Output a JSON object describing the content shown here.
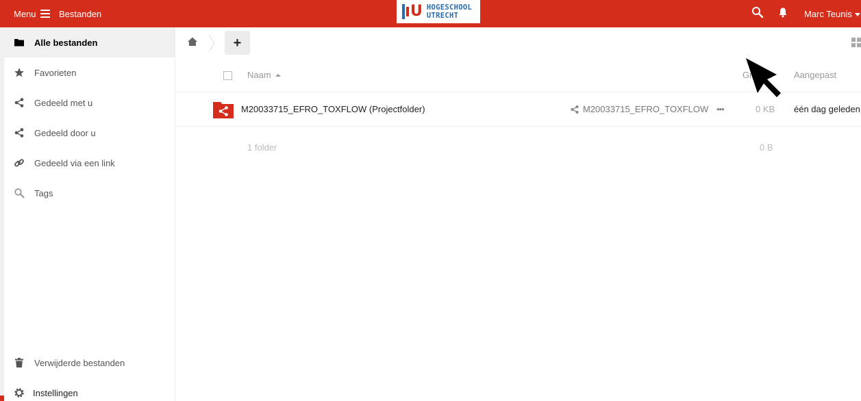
{
  "header": {
    "menu_label": "Menu",
    "app_title": "Bestanden",
    "logo": {
      "line1": "HOGESCHOOL",
      "line2": "UTRECHT",
      "mark": "U"
    },
    "user_name": "Marc Teunis",
    "colors": {
      "bar": "#d42d1b",
      "logo_blue": "#2b6cb0"
    }
  },
  "sidebar": {
    "items": [
      {
        "label": "Alle bestanden",
        "icon": "folder-icon",
        "active": true
      },
      {
        "label": "Favorieten",
        "icon": "star-icon"
      },
      {
        "label": "Gedeeld met u",
        "icon": "share-icon"
      },
      {
        "label": "Gedeeld door u",
        "icon": "share-icon"
      },
      {
        "label": "Gedeeld via een link",
        "icon": "link-icon"
      },
      {
        "label": "Tags",
        "icon": "search-icon"
      }
    ],
    "bottom": [
      {
        "label": "Verwijderde bestanden",
        "icon": "trash-icon"
      },
      {
        "label": "Instellingen",
        "icon": "gear-icon"
      }
    ]
  },
  "main": {
    "add_label": "+",
    "columns": {
      "name": "Naam",
      "size": "Grootte",
      "modified": "Aangepast"
    },
    "files": [
      {
        "name": "M20033715_EFRO_TOXFLOW (Projectfolder)",
        "shared_with": "M20033715_EFRO_TOXFLOW",
        "more": "•••",
        "size": "0 KB",
        "modified": "één dag geleden"
      }
    ],
    "summary": {
      "count": "1 folder",
      "size": "0 B"
    }
  }
}
